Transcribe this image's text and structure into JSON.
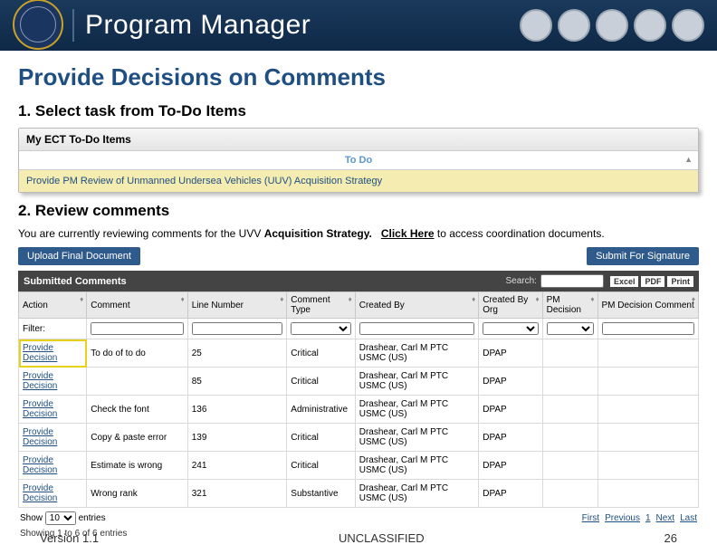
{
  "header": {
    "title": "Program Manager"
  },
  "slide": {
    "title": "Provide Decisions on Comments",
    "step1": "1. Select task from To-Do Items",
    "step2": "2.  Review comments"
  },
  "todo": {
    "panel_title": "My ECT To-Do Items",
    "column": "To Do",
    "task": "Provide PM Review of Unmanned Undersea Vehicles (UUV) Acquisition Strategy"
  },
  "review": {
    "prefix": "You are currently reviewing comments for the UVV ",
    "bold_part": "Acquisition Strategy.",
    "click_here": "Click Here",
    "suffix": " to access coordination documents."
  },
  "buttons": {
    "upload": "Upload Final Document",
    "submit": "Submit For Signature"
  },
  "comments_bar": {
    "title": "Submitted Comments",
    "search_label": "Search:",
    "exports": [
      "Excel",
      "PDF",
      "Print"
    ]
  },
  "table": {
    "headers": [
      "Action",
      "Comment",
      "Line Number",
      "Comment Type",
      "Created By",
      "Created By Org",
      "PM Decision",
      "PM Decision Comment"
    ],
    "filter_label": "Filter:",
    "rows": [
      {
        "action": "Provide Decision",
        "comment": "To do of to do",
        "line": "25",
        "type": "Critical",
        "by": "Drashear, Carl M PTC USMC (US)",
        "org": "DPAP",
        "pm": "",
        "pmc": ""
      },
      {
        "action": "Provide Decision",
        "comment": "",
        "line": "85",
        "type": "Critical",
        "by": "Drashear, Carl M PTC USMC (US)",
        "org": "DPAP",
        "pm": "",
        "pmc": ""
      },
      {
        "action": "Provide Decision",
        "comment": "Check the font",
        "line": "136",
        "type": "Administrative",
        "by": "Drashear, Carl M PTC USMC (US)",
        "org": "DPAP",
        "pm": "",
        "pmc": ""
      },
      {
        "action": "Provide Decision",
        "comment": "Copy & paste error",
        "line": "139",
        "type": "Critical",
        "by": "Drashear, Carl M PTC USMC (US)",
        "org": "DPAP",
        "pm": "",
        "pmc": ""
      },
      {
        "action": "Provide Decision",
        "comment": "Estimate is wrong",
        "line": "241",
        "type": "Critical",
        "by": "Drashear, Carl M PTC USMC (US)",
        "org": "DPAP",
        "pm": "",
        "pmc": ""
      },
      {
        "action": "Provide Decision",
        "comment": "Wrong rank",
        "line": "321",
        "type": "Substantive",
        "by": "Drashear, Carl M PTC USMC (US)",
        "org": "DPAP",
        "pm": "",
        "pmc": ""
      }
    ],
    "show_label": "Show",
    "entries_label": "entries",
    "show_value": "10",
    "showing": "Showing 1 to 6 of 6 entries",
    "pager": {
      "first": "First",
      "prev": "Previous",
      "page": "1",
      "next": "Next",
      "last": "Last"
    }
  },
  "footer": {
    "version": "Version 1.1",
    "classification": "UNCLASSIFIED",
    "page": "26"
  }
}
